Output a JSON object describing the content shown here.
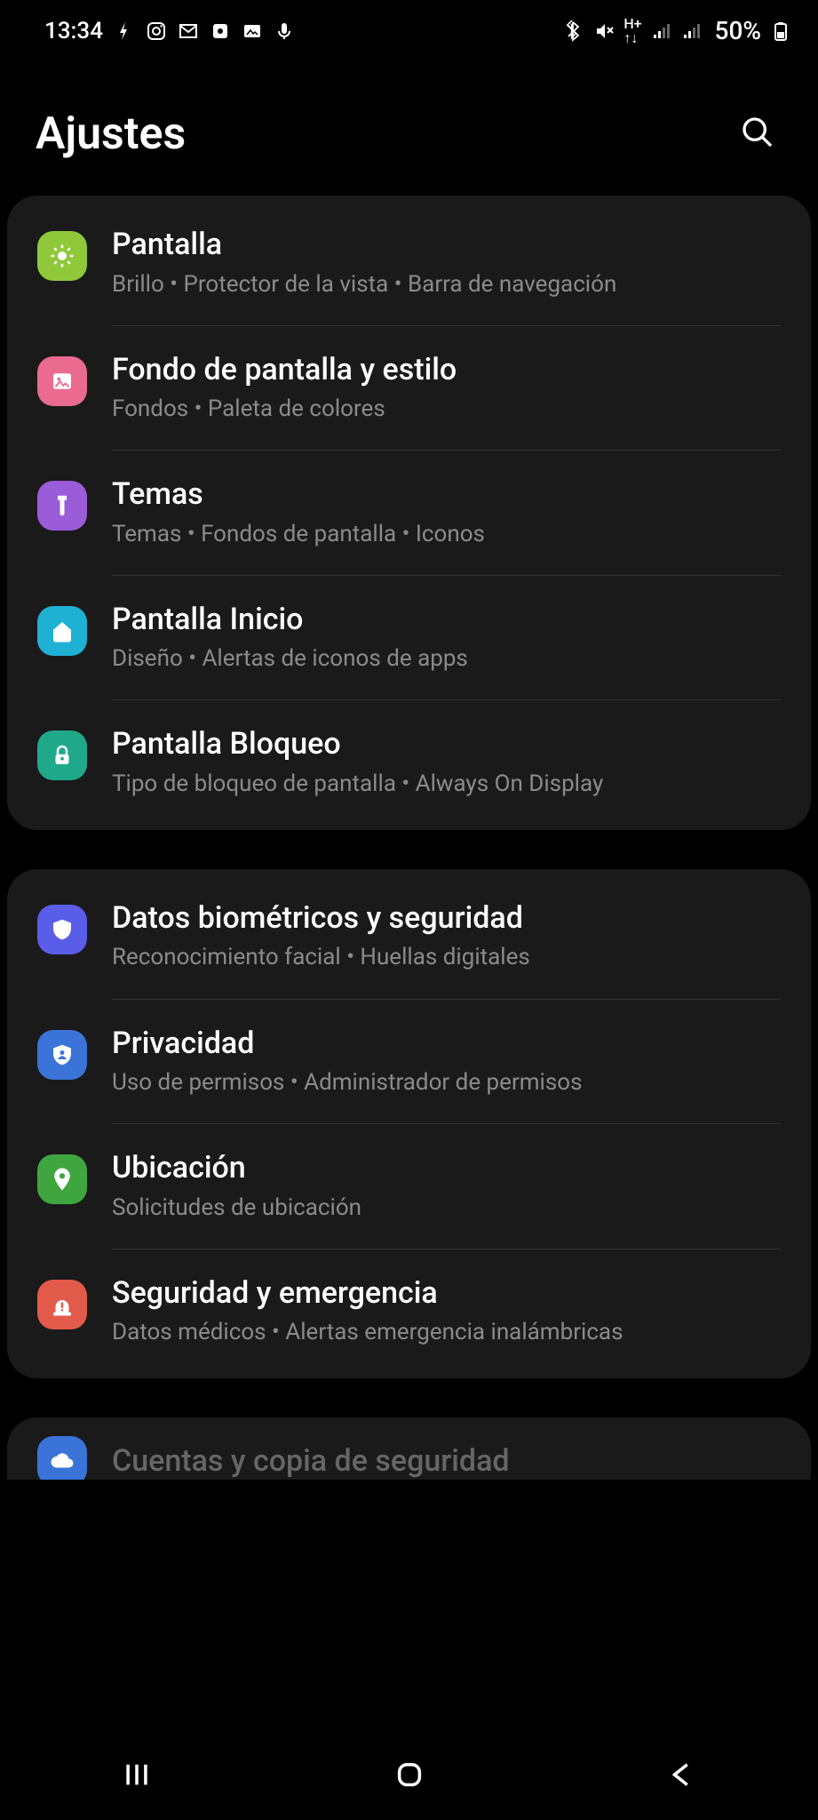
{
  "status": {
    "time": "13:34",
    "battery": "50%"
  },
  "header": {
    "title": "Ajustes"
  },
  "groups": [
    {
      "items": [
        {
          "icon": "sun-icon",
          "color": "bg-green",
          "title": "Pantalla",
          "sub": "Brillo  •  Protector de la vista  •  Barra de navegación"
        },
        {
          "icon": "image-icon",
          "color": "bg-pink",
          "title": "Fondo de pantalla y estilo",
          "sub": "Fondos  •  Paleta de colores"
        },
        {
          "icon": "brush-icon",
          "color": "bg-purple",
          "title": "Temas",
          "sub": "Temas  •  Fondos de pantalla  •  Iconos"
        },
        {
          "icon": "home-icon",
          "color": "bg-cyan",
          "title": "Pantalla Inicio",
          "sub": "Diseño  •  Alertas de iconos de apps"
        },
        {
          "icon": "lock-icon",
          "color": "bg-teal",
          "title": "Pantalla Bloqueo",
          "sub": "Tipo de bloqueo de pantalla  •  Always On Display"
        }
      ]
    },
    {
      "items": [
        {
          "icon": "shield-icon",
          "color": "bg-indigo",
          "title": "Datos biométricos y seguridad",
          "sub": "Reconocimiento facial  •  Huellas digitales"
        },
        {
          "icon": "shield-user-icon",
          "color": "bg-blue",
          "title": "Privacidad",
          "sub": "Uso de permisos  •  Administrador de permisos"
        },
        {
          "icon": "pin-icon",
          "color": "bg-green2",
          "title": "Ubicación",
          "sub": "Solicitudes de ubicación"
        },
        {
          "icon": "siren-icon",
          "color": "bg-red",
          "title": "Seguridad y emergencia",
          "sub": "Datos médicos  •  Alertas emergencia inalámbricas"
        }
      ]
    }
  ],
  "peek": {
    "icon": "cloud-icon",
    "color": "bg-blue2",
    "title": "Cuentas y copia de seguridad"
  }
}
